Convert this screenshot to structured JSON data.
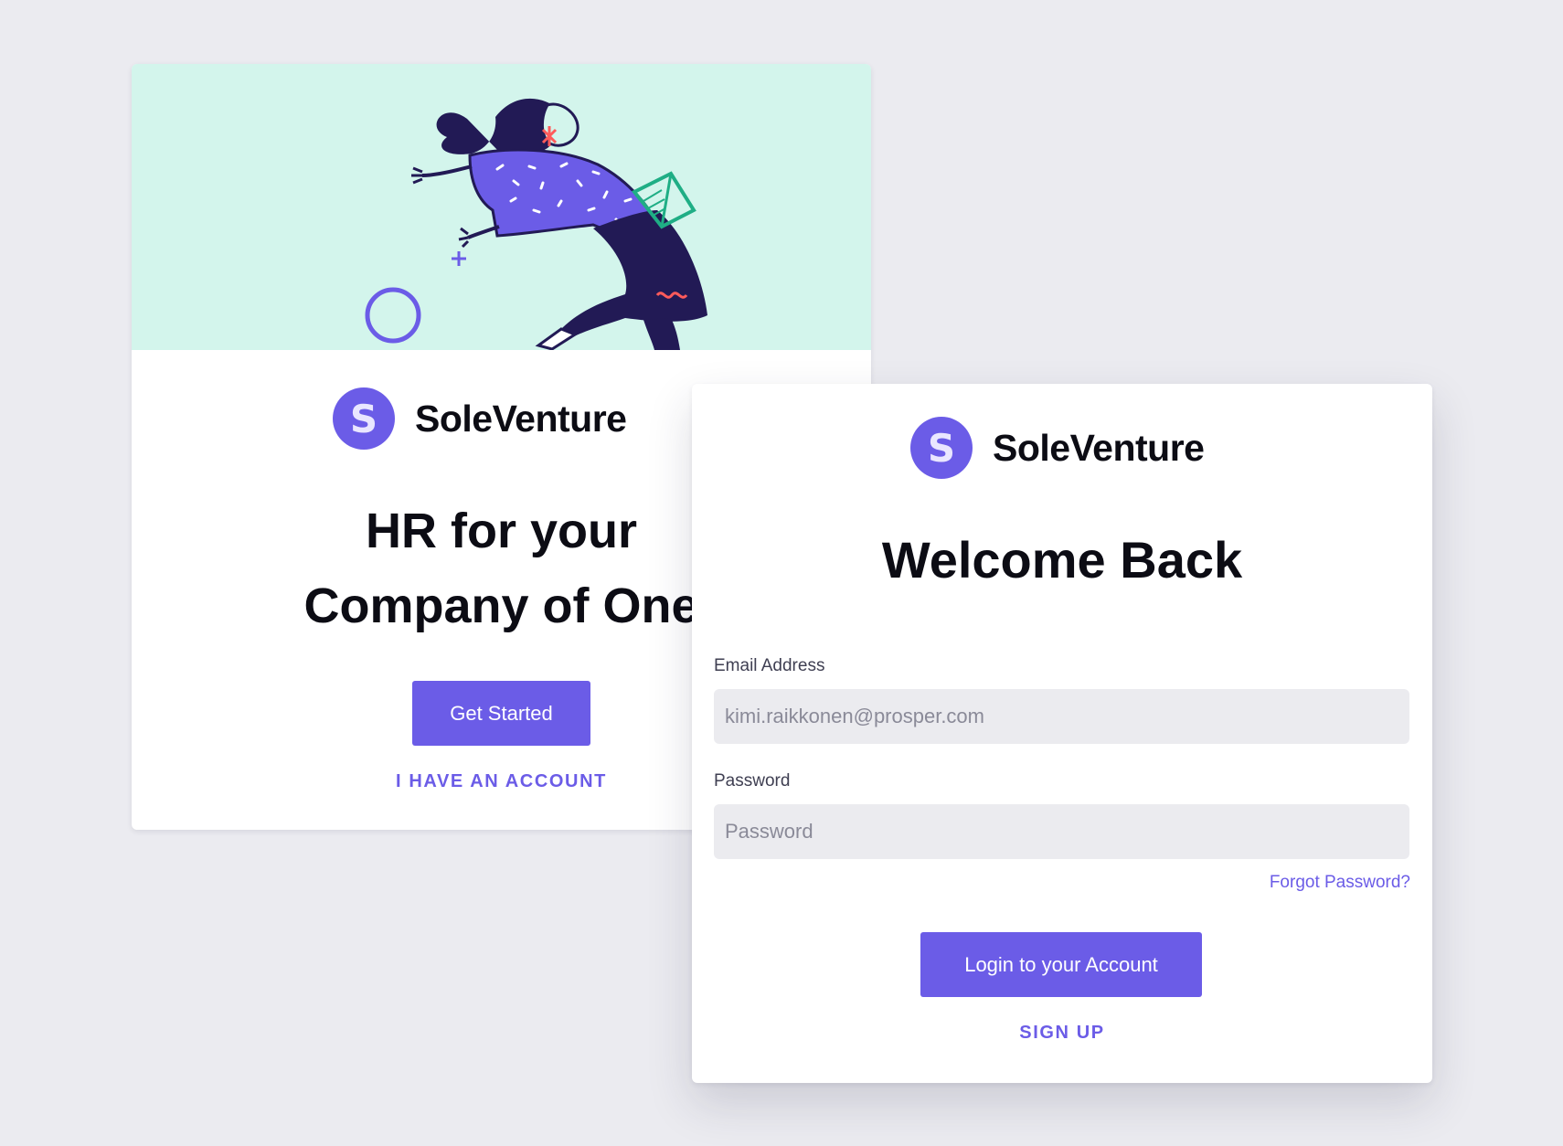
{
  "colors": {
    "background": "#ebebf0",
    "brand_purple": "#6b5ce7",
    "hero_mint": "#d3f5ec",
    "text_dark": "#0c0c14",
    "input_bg": "#ebebef"
  },
  "onboarding": {
    "illustration": "woman-flying-illustration",
    "brand": {
      "mark": "S",
      "name": "SoleVenture"
    },
    "headline": [
      "HR for your",
      "Company of One"
    ],
    "get_started_label": "Get Started",
    "have_account_label": "I HAVE AN ACCOUNT"
  },
  "login": {
    "brand": {
      "mark": "S",
      "name": "SoleVenture"
    },
    "title": "Welcome Back",
    "email": {
      "label": "Email Address",
      "placeholder": "kimi.raikkonen@prosper.com"
    },
    "password": {
      "label": "Password",
      "placeholder": "Password"
    },
    "forgot_label": "Forgot Password?",
    "login_label": "Login to your Account",
    "signup_label": "SIGN UP"
  }
}
